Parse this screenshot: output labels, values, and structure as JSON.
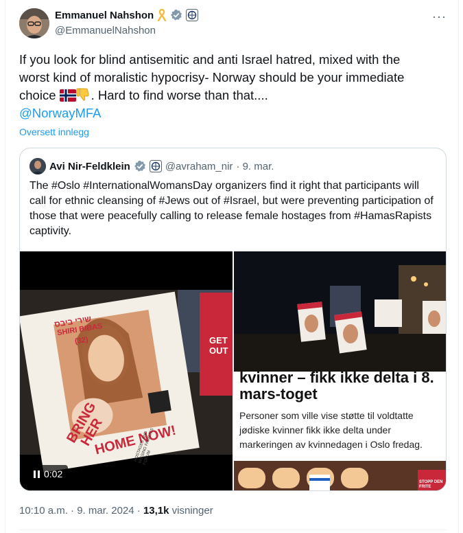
{
  "tweet": {
    "author_name": "Emmanuel Nahshon",
    "author_handle": "@EmmanuelNahshon",
    "text_line1": "If you look for blind antisemitic and anti Israel hatred, mixed with the",
    "text_line2": "worst kind of moralistic hypocrisy- Norway should be your immediate",
    "text_line3_a": "choice",
    "text_line3_b": ". Hard to find worse than that....",
    "mention": "@NorwayMFA",
    "translate_label": "Oversett innlegg",
    "more_label": "···"
  },
  "quoted": {
    "author_name": "Avi Nir-Feldklein",
    "author_handle": "@avraham_nir",
    "date": "· 9. mar.",
    "text": "The #Oslo #InternationalWomansDay organizers find it right that participants will call for ethnic cleansing of #Jews out of #Israel, but were preventing participation of those that were peacefully  calling to release female hostages from #HamasRapists captivity.",
    "video_time": "0:02",
    "poster_texts": {
      "hebrew": "שירי ביבס",
      "name": "SHIRI BIBAS",
      "age": "(32)",
      "bring": "BRING",
      "her": "HER",
      "home_now": "HOME NOW!",
      "forum": "HOSTAGES AND MISSING FAMILIES FORUM",
      "get_out": "GET OUT"
    },
    "article": {
      "headline1": "kvinner – fikk ikke delta i 8.",
      "headline2": "mars-toget",
      "body": "Personer som ville vise støtte til voldtatte jødiske kvinner fikk ikke delta under markeringen av kvinnedagen i Oslo fredag.",
      "sign": "STOPP DEN FRITE"
    }
  },
  "footer": {
    "time": "10:10 a.m. · 9. mar. 2024 ·",
    "views_count": "13,1k",
    "views_label": "visninger"
  },
  "colors": {
    "link": "#1d9bf0",
    "secondary": "#536471",
    "border": "#cfd9de",
    "verified": "#829aab"
  },
  "icons": [
    "ribbon-icon",
    "verified-badge-icon",
    "org-badge-icon",
    "norway-flag-icon",
    "thumbs-down-icon",
    "pause-icon"
  ]
}
